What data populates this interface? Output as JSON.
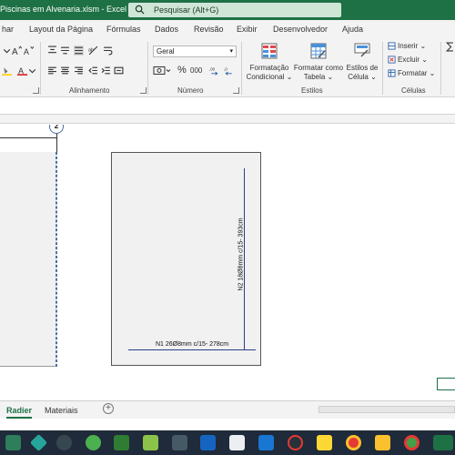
{
  "window": {
    "title": "Piscinas em Alvenaria.xlsm  -  Excel",
    "search_placeholder": "Pesquisar (Alt+G)"
  },
  "menu_tabs": [
    "har",
    "Layout da Página",
    "Fórmulas",
    "Dados",
    "Revisão",
    "Exibir",
    "Desenvolvedor",
    "Ajuda"
  ],
  "ribbon": {
    "groups": {
      "alignment": "Alinhamento",
      "number": "Número",
      "styles": "Estilos",
      "cells": "Células"
    },
    "number_format": "Geral",
    "styles_buttons": {
      "conditional": [
        "Formatação",
        "Condicional ⌄"
      ],
      "table": [
        "Formatar como",
        "Tabela ⌄"
      ],
      "cell_styles": [
        "Estilos de",
        "Célula ⌄"
      ]
    },
    "cells_buttons": [
      "Inserir",
      "Excluir",
      "Formatar"
    ],
    "percent_symbol": "%",
    "thousands_symbol": "000"
  },
  "sheet": {
    "marker_number": "2",
    "rebar_label_vertical": "N2 18Ø8mm c/15- 393cm",
    "rebar_label_horizontal": "N1 26Ø8mm c/15- 278cm"
  },
  "sheet_tabs": {
    "active": "Radier",
    "other": "Materiais",
    "add_symbol": "+"
  },
  "colors": {
    "excel_green": "#1e7145",
    "rebar_blue": "#2c3e8c",
    "taskbar": "#1f2a3a"
  },
  "taskbar_icons": [
    "app-icon-1",
    "app-icon-2",
    "app-icon-3",
    "app-icon-4",
    "app-icon-5",
    "app-icon-6",
    "app-icon-7",
    "app-icon-8",
    "app-icon-9",
    "app-icon-10",
    "app-icon-11",
    "app-icon-12",
    "app-icon-13",
    "app-icon-14",
    "app-icon-15",
    "app-icon-16",
    "app-icon-17",
    "app-icon-18",
    "app-icon-19"
  ]
}
